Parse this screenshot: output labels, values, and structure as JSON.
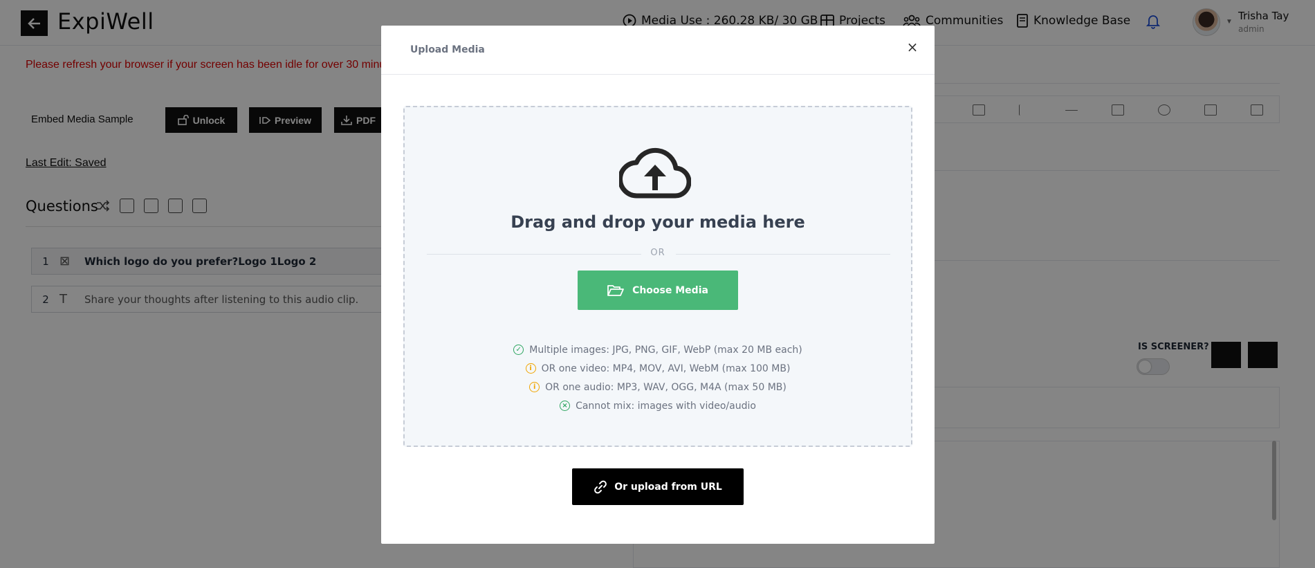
{
  "app": {
    "brand": "ExpiWell",
    "media_use": "Media Use : 260.28 KB/ 30 GB",
    "nav_projects": "Projects",
    "nav_communities": "Communities",
    "nav_knowledge": "Knowledge Base",
    "user_name": "Trisha Tay",
    "user_role": "admin"
  },
  "page": {
    "warning": "Please refresh your browser if your screen has been idle for over 30 minu",
    "embed_title": "Embed Media Sample",
    "unlock_label": "Unlock",
    "preview_label": "Preview",
    "pdf_label": "PDF",
    "last_edit": "Last Edit: Saved",
    "questions_title": "Questions",
    "questions": [
      {
        "num": "1",
        "text": "Which logo do you prefer?Logo 1Logo 2"
      },
      {
        "num": "2",
        "text": "Share your thoughts after listening to this audio clip."
      }
    ],
    "screener_label": "IS SCREENER?"
  },
  "modal": {
    "title": "Upload Media",
    "close": "×",
    "drop_title": "Drag and drop your media here",
    "or": "OR",
    "choose_label": "Choose Media",
    "rules": [
      {
        "icon": "check-circle-icon",
        "color": "#2fa661",
        "glyph": "✓",
        "text": "Multiple images: JPG, PNG, GIF, WebP (max 20 MB each)"
      },
      {
        "icon": "info-circle-icon",
        "color": "#f0a500",
        "glyph": "i",
        "text": "OR one video: MP4, MOV, AVI, WebM (max 100 MB)"
      },
      {
        "icon": "info-circle-icon",
        "color": "#f0a500",
        "glyph": "i",
        "text": "OR one audio: MP3, WAV, OGG, M4A (max 50 MB)"
      },
      {
        "icon": "x-circle-icon",
        "color": "#2fa661",
        "glyph": "×",
        "text": "Cannot mix: images with video/audio"
      }
    ],
    "url_label": "Or upload from URL"
  },
  "colors": {
    "choose_button": "#4ab878",
    "url_button": "#000000",
    "warning_text": "#dd0000"
  }
}
